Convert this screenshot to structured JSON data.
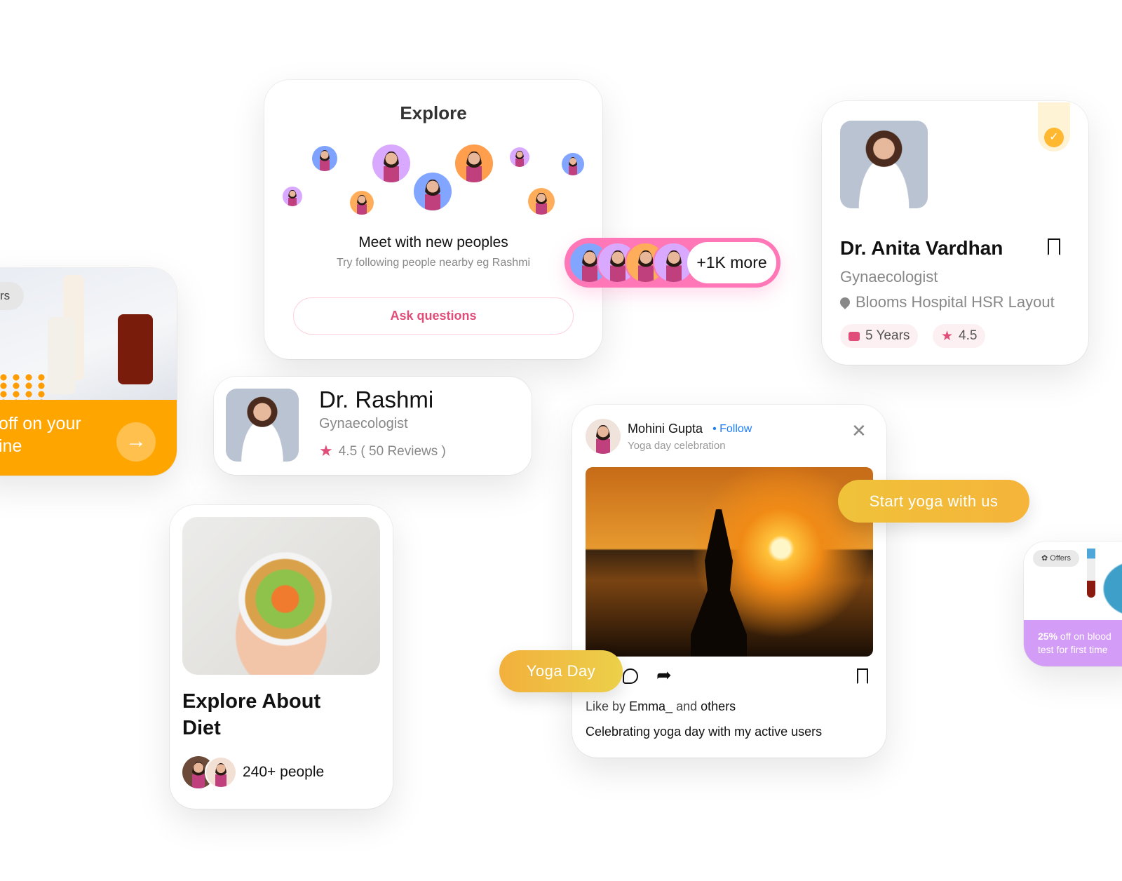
{
  "promo_card": {
    "chip": "rs",
    "text_line1": "off on your",
    "text_line2": "ine",
    "color": "#ffa500"
  },
  "explore": {
    "title": "Explore",
    "heading": "Meet with new peoples",
    "subtitle": "Try  following people nearby eg Rashmi",
    "button": "Ask questions"
  },
  "more_pill": {
    "label": "+1K more",
    "color": "#ff77b7"
  },
  "anita": {
    "name": "Dr. Anita Vardhan",
    "specialty": "Gynaecologist",
    "location": "Blooms Hospital HSR Layout",
    "experience": "5 Years",
    "rating": "4.5"
  },
  "rashmi": {
    "name": "Dr. Rashmi",
    "specialty": "Gynaecologist",
    "rating": "4.5 ( 50 Reviews )"
  },
  "diet": {
    "title_line1": "Explore About",
    "title_line2": "Diet",
    "people": "240+ people"
  },
  "post": {
    "author": "Mohini Gupta",
    "follow": "Follow",
    "subtitle": "Yoga day celebration",
    "like_prefix": "Like by",
    "like_user": "Emma_",
    "like_mid": "and",
    "like_others": "others",
    "caption": "Celebrating yoga day with my active users"
  },
  "start_yoga": {
    "label": "Start yoga with us"
  },
  "yoga_day": {
    "label": "Yoga Day"
  },
  "offers": {
    "chip": "Offers",
    "bold": "25%",
    "text1": " off on blood",
    "text2": "test for first time",
    "color": "#d39cf6"
  }
}
